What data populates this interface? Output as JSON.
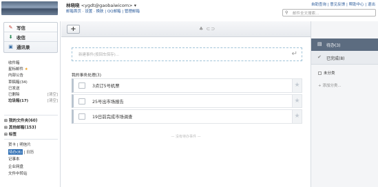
{
  "header": {
    "user_name": "林晓晓",
    "user_email": "<ygdt@gaobaiwicom>",
    "nav_links": "邮箱首页 · 设置 · 换肤 | QQ邮箱 | 管理邮箱",
    "top_links": "自助查询 | 意见反馈 | 帮助中心 | 退出",
    "search_placeholder": "邮件全文搜索..."
  },
  "sidebar": {
    "quick": [
      {
        "label": "写信",
        "icon": "pencil-icon"
      },
      {
        "label": "收信",
        "icon": "inbox-icon"
      },
      {
        "label": "通讯录",
        "icon": "contacts-icon"
      }
    ],
    "folders": [
      {
        "label": "收件箱"
      },
      {
        "label": "星标邮件"
      },
      {
        "label": "内部公告"
      },
      {
        "label": "草稿箱(34)"
      },
      {
        "label": "已发送"
      },
      {
        "label": "已删除",
        "action": "[清空]"
      },
      {
        "label": "垃圾箱(17)",
        "action": "[清空]"
      }
    ],
    "groups": [
      "我的文件夹(60)",
      "其他邮箱(153)",
      "标签"
    ],
    "bottom": {
      "row1": "贺卡 | 明信片",
      "row2_active": "待办(8)",
      "row2_rest": " | 日历",
      "row3": "记事本",
      "row4": "企业网盘",
      "row5": "文件中转站"
    }
  },
  "toolbar": {
    "add_label": "+",
    "icons": "♣ ⊂⊃"
  },
  "main": {
    "new_task_placeholder": "新建事件(按回车保存)...",
    "enter_symbol": "↵",
    "section_title": "我的事务处理(3)",
    "tasks": [
      {
        "text": "3点订5号机票"
      },
      {
        "text": "25号出市场报告"
      },
      {
        "text": "19日前完成市场调查"
      }
    ],
    "footer_note": "— 没有待办事件 —"
  },
  "right_panel": {
    "pending": "待办(3)",
    "done": "已完成(8)",
    "uncategorized": "未分类",
    "add_category": "+ 添加分类..."
  },
  "colors": {
    "accent": "#2f6fb4",
    "pending_bg": "#5c6c80",
    "link": "#2a5a9a"
  }
}
